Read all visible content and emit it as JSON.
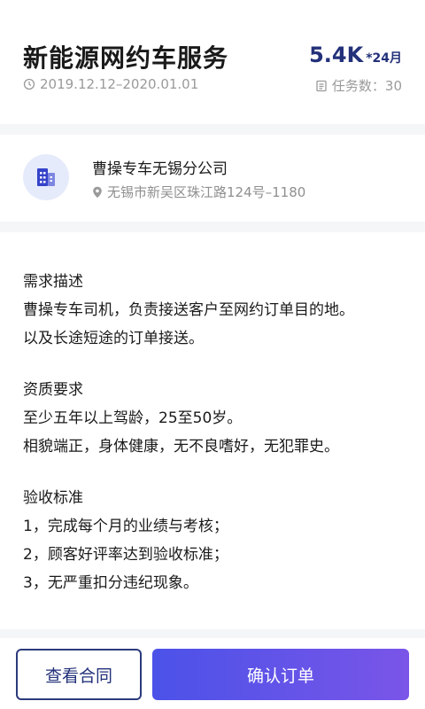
{
  "job": {
    "title": "新能源网约车服务",
    "price_amount": "5.4K",
    "price_unit": "*24月",
    "date_range": "2019.12.12–2020.01.01",
    "tasks": "任务数：30"
  },
  "company": {
    "name": "曹操专车无锡分公司",
    "address": "无锡市新吴区珠江路124号–1180"
  },
  "description": {
    "sections": [
      {
        "title": "需求描述",
        "lines": [
          "曹操专车司机，负责接送客户至网约订单目的地。",
          "以及长途短途的订单接送。"
        ]
      },
      {
        "title": "资质要求",
        "lines": [
          "至少五年以上驾龄，25至50岁。",
          "相貌端正，身体健康，无不良嗜好，无犯罪史。"
        ]
      },
      {
        "title": "验收标准",
        "lines": [
          "1，完成每个月的业绩与考核；",
          "2，顾客好评率达到验收标准；",
          "3，无严重扣分违纪现象。"
        ]
      }
    ]
  },
  "actions": {
    "view_contract": "查看合同",
    "confirm_order": "确认订单"
  },
  "colors": {
    "accent": "#23317a",
    "button_gradient_start": "#4b52e8",
    "button_gradient_end": "#7a55e8"
  },
  "icons": {
    "date": "clock-icon",
    "tasks": "document-icon",
    "company": "building-icon",
    "address": "location-pin-icon"
  }
}
